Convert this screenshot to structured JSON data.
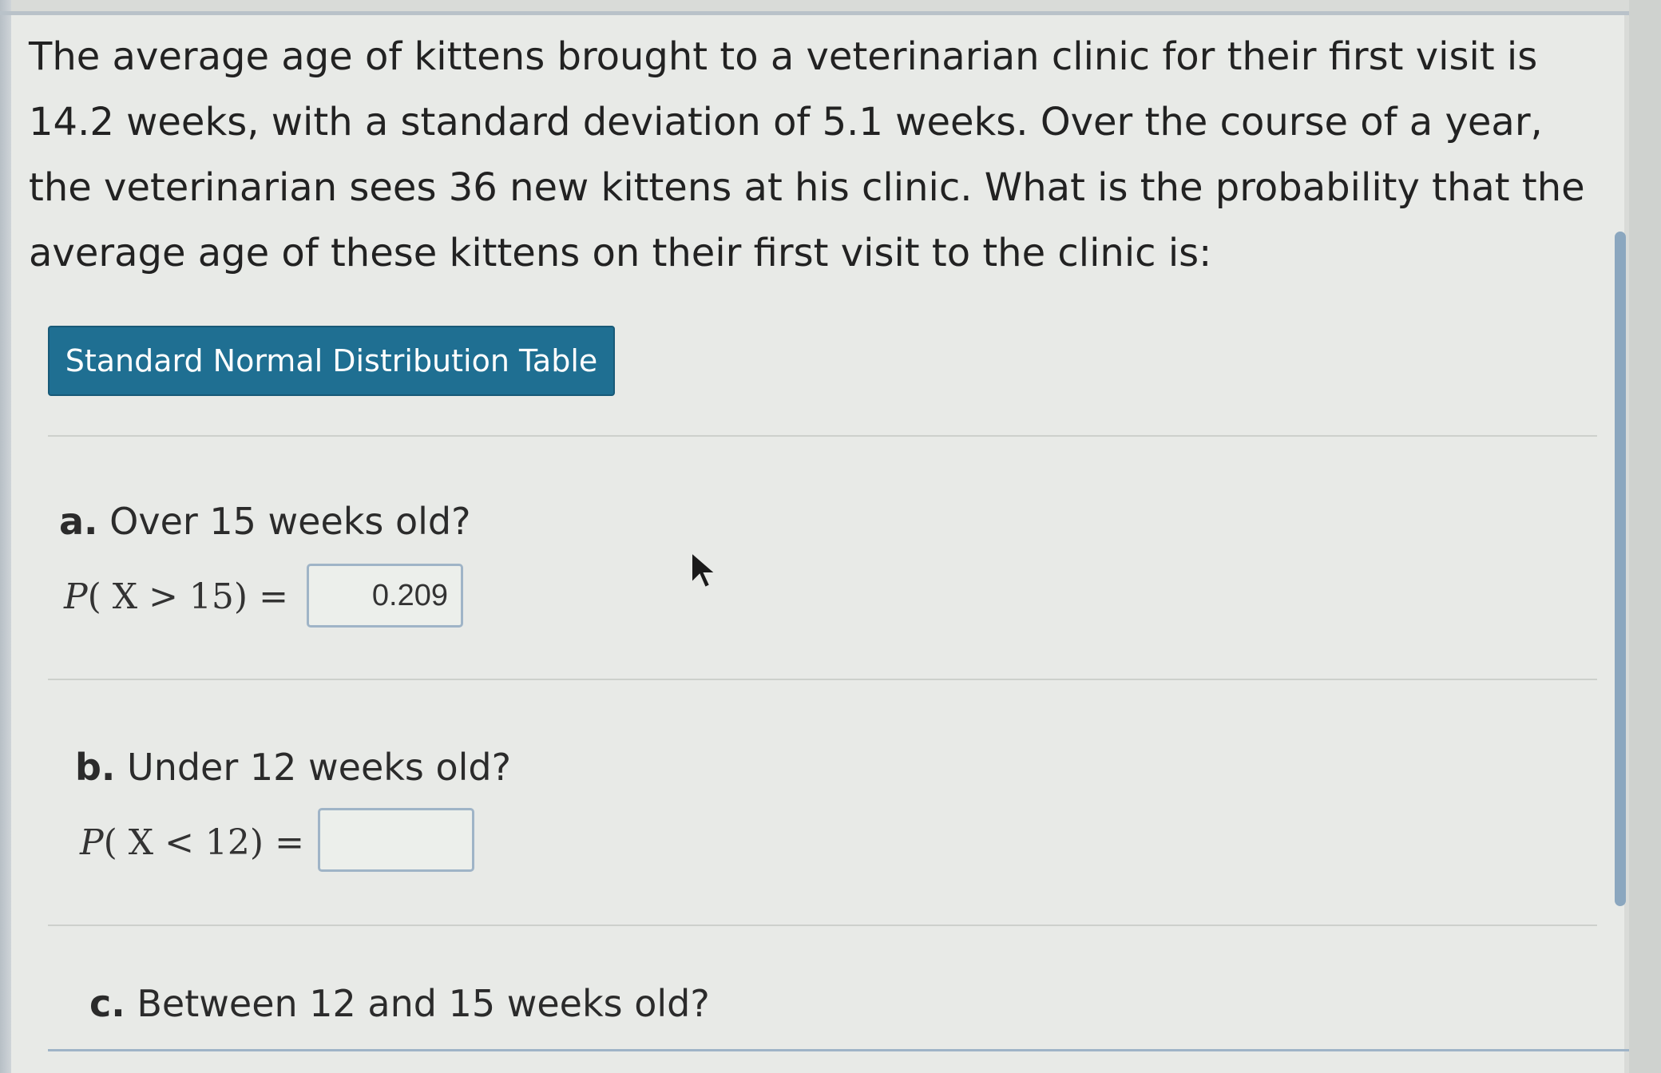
{
  "question": {
    "text": "The average age of kittens brought to a veterinarian clinic for their first visit is 14.2 weeks, with a standard deviation of 5.1 weeks. Over the course of a year, the veterinarian sees 36 new kittens at his clinic. What is the probability that the average age of these kittens on their first visit to the clinic is:"
  },
  "table_button": {
    "label": "Standard Normal Distribution Table"
  },
  "parts": [
    {
      "letter": "a.",
      "prompt": "Over 15 weeks old?",
      "eq_p": "P",
      "eq_body": "( X > 15) =",
      "answer": "0.209"
    },
    {
      "letter": "b.",
      "prompt": "Under 12 weeks old?",
      "eq_p": "P",
      "eq_body": "( X < 12) =",
      "answer": ""
    },
    {
      "letter": "c.",
      "prompt": "Between 12 and 15 weeks old?"
    }
  ],
  "icons": {
    "cursor": "mouse-pointer-icon"
  },
  "colors": {
    "button_bg": "#1f6f92",
    "input_border": "#9fb4c7",
    "panel_bg": "#e8eae7"
  }
}
